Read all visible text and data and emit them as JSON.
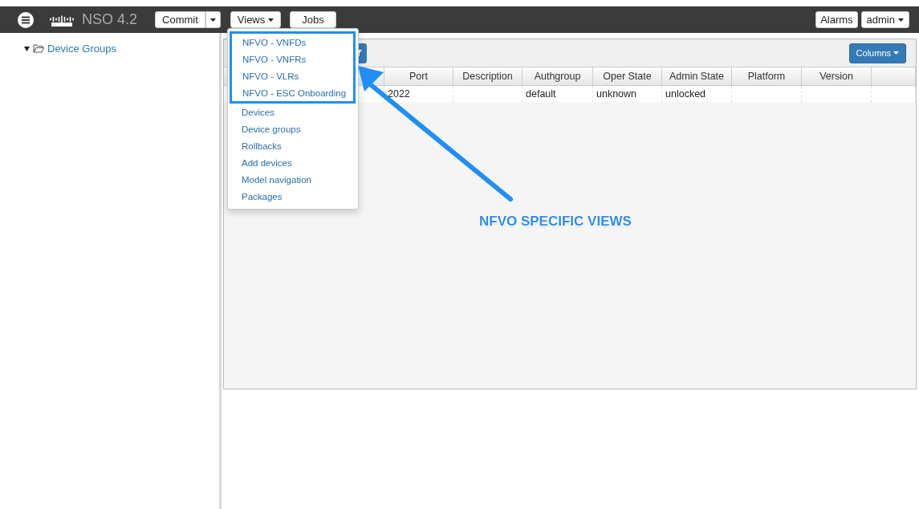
{
  "topbar": {
    "brand": "NSO 4.2",
    "commit": "Commit",
    "views": "Views",
    "jobs": "Jobs",
    "alarms": "Alarms",
    "user": "admin"
  },
  "sidebar": {
    "items": [
      {
        "label": "Device Groups",
        "expanded": true
      }
    ]
  },
  "toolbar": {
    "columns_button": "Columns"
  },
  "table": {
    "columns": [
      "Port",
      "Description",
      "Authgroup",
      "Oper State",
      "Admin State",
      "Platform",
      "Version"
    ],
    "rows": [
      [
        "2022",
        "",
        "default",
        "unknown",
        "unlocked",
        "",
        ""
      ]
    ]
  },
  "views_menu": {
    "items": [
      {
        "label": "NFVO - VNFDs",
        "highlighted": true
      },
      {
        "label": "NFVO - VNFRs",
        "highlighted": true
      },
      {
        "label": "NFVO - VLRs",
        "highlighted": true
      },
      {
        "label": "NFVO - ESC Onboarding",
        "highlighted": true
      },
      {
        "label": "Devices",
        "highlighted": false
      },
      {
        "label": "Device groups",
        "highlighted": false
      },
      {
        "label": "Rollbacks",
        "highlighted": false
      },
      {
        "label": "Add devices",
        "highlighted": false
      },
      {
        "label": "Model navigation",
        "highlighted": false
      },
      {
        "label": "Packages",
        "highlighted": false
      }
    ]
  },
  "annotation": {
    "label": "NFVO SPECIFIC VIEWS"
  }
}
